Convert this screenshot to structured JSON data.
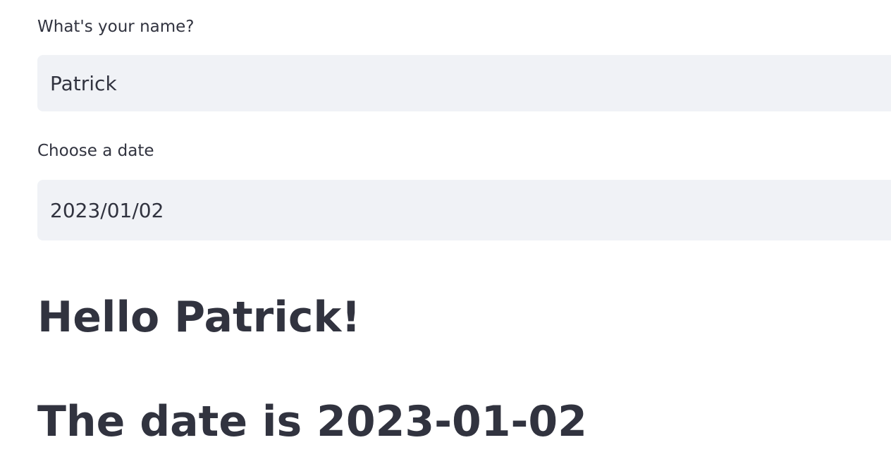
{
  "name_input": {
    "label": "What's your name?",
    "value": "Patrick"
  },
  "date_input": {
    "label": "Choose a date",
    "value": "2023/01/02"
  },
  "output": {
    "greeting": "Hello Patrick!",
    "date_text": "The date is 2023-01-02"
  }
}
